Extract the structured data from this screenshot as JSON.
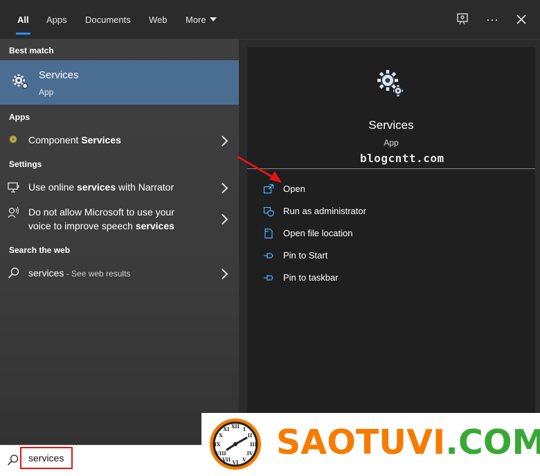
{
  "tabs": [
    {
      "label": "All",
      "active": true
    },
    {
      "label": "Apps"
    },
    {
      "label": "Documents"
    },
    {
      "label": "Web"
    },
    {
      "label": "More"
    }
  ],
  "sections": {
    "best_match": "Best match",
    "apps": "Apps",
    "settings": "Settings",
    "search_web": "Search the web"
  },
  "best_match": {
    "title": "Services",
    "subtitle": "App"
  },
  "apps": [
    {
      "pre": "Component ",
      "bold": "Services",
      "post": ""
    }
  ],
  "settings": [
    {
      "pre": "Use online ",
      "bold": "services",
      "post": " with Narrator"
    },
    {
      "line1": "Do not allow Microsoft to use your",
      "line2_pre": "voice to improve speech ",
      "line2_bold": "services"
    }
  ],
  "web": {
    "query": "services",
    "hint": " - See web results"
  },
  "detail": {
    "title": "Services",
    "subtitle": "App",
    "watermark": "blogcntt.com",
    "actions": [
      {
        "label": "Open",
        "icon": "open-window-icon"
      },
      {
        "label": "Run as administrator",
        "icon": "shield-icon"
      },
      {
        "label": "Open file location",
        "icon": "file-location-icon"
      },
      {
        "label": "Pin to Start",
        "icon": "pin-icon"
      },
      {
        "label": "Pin to taskbar",
        "icon": "pin-icon"
      }
    ]
  },
  "search": {
    "value": "services"
  },
  "brand": {
    "part1": "SAOTU",
    "part2": "VI",
    "part3": ".COM"
  },
  "colors": {
    "accent": "#2f8ff0",
    "selection": "#4a6e91",
    "action_icon": "#4fb0ff",
    "brand_orange": "#f57c00",
    "brand_green": "#39a935",
    "highlight_red": "#e01515"
  }
}
